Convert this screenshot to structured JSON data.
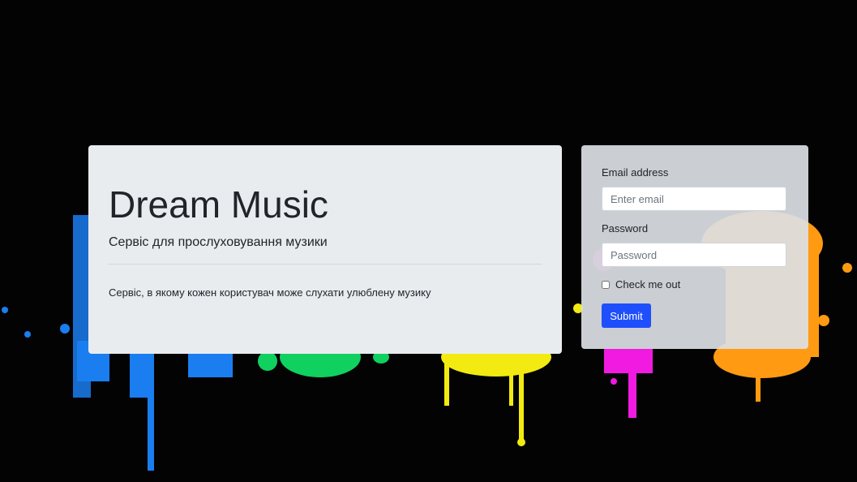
{
  "jumbotron": {
    "title": "Dream Music",
    "lead": "Сервіс для прослуховування музики",
    "description": "Сервіс, в якому кожен користувач може слухати улюблену музику"
  },
  "login_form": {
    "email_label": "Email address",
    "email_placeholder": "Enter email",
    "password_label": "Password",
    "password_placeholder": "Password",
    "checkbox_label": "Check me out",
    "submit_label": "Submit"
  },
  "colors": {
    "page_background": "#030303",
    "card_background": "#e9ecef",
    "primary_button": "#1f4ffc",
    "paint_blue": "#1a7ef0",
    "paint_green": "#10d060",
    "paint_yellow": "#f2ea10",
    "paint_magenta": "#f01ae0",
    "paint_orange": "#ff9a12"
  }
}
